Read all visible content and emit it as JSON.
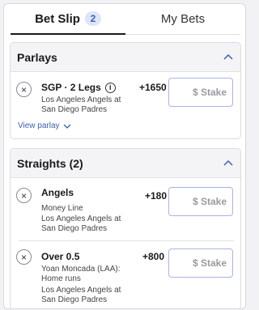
{
  "tabs": {
    "bet_slip": {
      "label": "Bet Slip",
      "count": "2"
    },
    "my_bets": {
      "label": "My Bets"
    }
  },
  "parlays": {
    "title": "Parlays",
    "leg": {
      "title": "SGP · 2 Legs",
      "matchup": "Los Angeles Angels at San Diego Padres",
      "odds": "+1650",
      "stake_placeholder": "$ Stake"
    },
    "view_parlay": "View parlay"
  },
  "straights": {
    "title": "Straights (2)",
    "bets": [
      {
        "selection": "Angels",
        "market": "Money Line",
        "matchup": "Los Angeles Angels at San Diego Padres",
        "odds": "+180",
        "stake_placeholder": "$ Stake"
      },
      {
        "selection": "Over 0.5",
        "market": "Yoan Moncada (LAA): Home runs",
        "matchup": "Los Angeles Angels at San Diego Padres",
        "odds": "+800",
        "stake_placeholder": "$ Stake"
      }
    ]
  },
  "icons": {
    "close": "×",
    "info": "i",
    "collapse": "chevron-up",
    "expand": "chevron-down"
  },
  "colors": {
    "accent": "#3b5fb0",
    "badge_bg": "#dde6f8",
    "stake_border": "#a9b4e6"
  }
}
